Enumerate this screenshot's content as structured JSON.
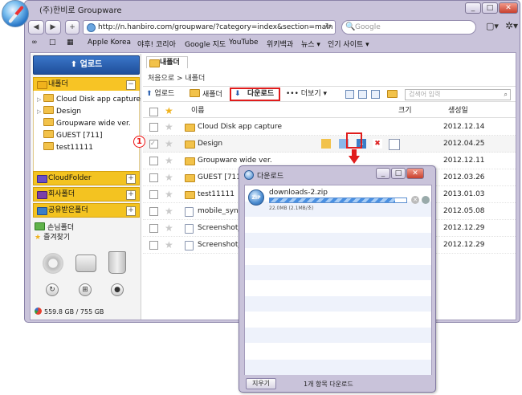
{
  "window": {
    "title": "(주)한비로 Groupware",
    "controls": [
      "_",
      "□",
      "✕"
    ]
  },
  "nav": {
    "back": "◀",
    "forward": "▶",
    "add": "+",
    "url": "http://n.hanbiro.com/groupware/?category=index&section=main",
    "reload_icon": "↻",
    "search_placeholder": "Google",
    "search_icon": "🔍",
    "page_icon": "▢▾",
    "gear_icon": "✲▾"
  },
  "bookmarks": [
    "Apple Korea",
    "야후! 코리아",
    "Google 지도",
    "YouTube",
    "위키백과",
    "뉴스 ▾",
    "인기 사이트 ▾"
  ],
  "bookmark_icons": [
    "∞",
    "□",
    "▦"
  ],
  "sidebar": {
    "upload_label": "업로드",
    "my_folder": "내폴더",
    "tree": [
      "Cloud Disk app capture",
      "Design",
      "Groupware wide ver.",
      "GUEST [711]",
      "test11111"
    ],
    "sections": [
      "CloudFolder",
      "회사폴더",
      "공유받은폴더"
    ],
    "links": [
      "손님폴더",
      "즐겨찾기"
    ],
    "storage": "559.8 GB / 755 GB"
  },
  "panel": {
    "tab": "내폴더",
    "breadcrumb": "처음으로  >  내폴더",
    "toolbar": {
      "upload": "업로드",
      "new_folder": "새폴더",
      "download": "다운로드",
      "more": "••• 더보기 ▾",
      "search_placeholder": "검색어 입력"
    },
    "columns": {
      "name": "이름",
      "size": "크기",
      "date": "생성일"
    },
    "rows": [
      {
        "name": "Cloud Disk app capture",
        "date": "2012.12.14",
        "type": "folder"
      },
      {
        "name": "Design",
        "date": "2012.04.25",
        "type": "folder"
      },
      {
        "name": "Groupware wide ver.",
        "date": "2012.12.11",
        "type": "folder"
      },
      {
        "name": "GUEST [711]",
        "date": "2012.03.26",
        "type": "folder"
      },
      {
        "name": "test11111",
        "date": "2013.01.03",
        "type": "folder"
      },
      {
        "name": "mobile_sync",
        "date": "2012.05.08",
        "type": "file"
      },
      {
        "name": "Screenshot_",
        "date": "2012.12.29",
        "type": "file"
      },
      {
        "name": "Screenshot_",
        "date": "2012.12.29",
        "type": "file"
      }
    ],
    "step_marker": "1"
  },
  "download_dialog": {
    "title": "다운로드",
    "filename": "downloads-2.zip",
    "zip_label": "ZIP",
    "size_text": "22.0MB (2.1MB/초)",
    "progress": 0.92,
    "stop_icon": "✕",
    "reveal_icon": "🔍",
    "clear_button": "지우기",
    "status": "1개 항목 다운로드",
    "controls": [
      "_",
      "□",
      "✕"
    ]
  },
  "colors": {
    "accent_red": "#e01c1c",
    "folder_yellow": "#f7c425",
    "upload_blue": "#2a5fb0"
  }
}
